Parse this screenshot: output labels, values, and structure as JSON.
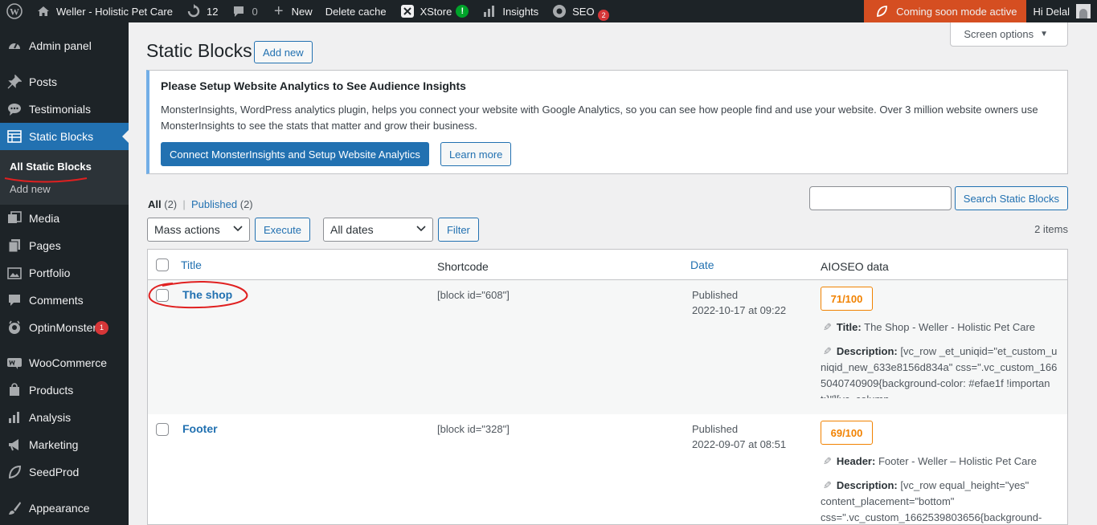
{
  "adminbar": {
    "site_name": "Weller - Holistic Pet Care",
    "updates_count": "12",
    "comments_count": "0",
    "new_label": "New",
    "delete_cache_label": "Delete cache",
    "xstore_label": "XStore",
    "insights_label": "Insights",
    "seo_label": "SEO",
    "seo_badge": "2",
    "coming_soon_label": "Coming soon mode active",
    "greeting": "Hi Delal"
  },
  "sidebar": {
    "items": [
      {
        "label": "Admin panel",
        "icon": "dashboard-icon"
      },
      {
        "label": "Posts",
        "icon": "pin-icon"
      },
      {
        "label": "Testimonials",
        "icon": "speech-bubble-icon"
      },
      {
        "label": "Static Blocks",
        "icon": "table-icon"
      },
      {
        "label": "Media",
        "icon": "media-icon"
      },
      {
        "label": "Pages",
        "icon": "pages-icon"
      },
      {
        "label": "Portfolio",
        "icon": "portfolio-icon"
      },
      {
        "label": "Comments",
        "icon": "comment-icon"
      },
      {
        "label": "OptinMonster",
        "icon": "optinmonster-icon",
        "badge": "1"
      },
      {
        "label": "WooCommerce",
        "icon": "woo-icon"
      },
      {
        "label": "Products",
        "icon": "archive-icon"
      },
      {
        "label": "Analysis",
        "icon": "bar-chart-icon"
      },
      {
        "label": "Marketing",
        "icon": "megaphone-icon"
      },
      {
        "label": "SeedProd",
        "icon": "seedprod-icon"
      },
      {
        "label": "Appearance",
        "icon": "brush-icon"
      }
    ],
    "submenu": {
      "all_label": "All Static Blocks",
      "add_label": "Add new"
    }
  },
  "main": {
    "screen_options_label": "Screen options",
    "page_title": "Static Blocks",
    "add_new_label": "Add new",
    "notice": {
      "title": "Please Setup Website Analytics to See Audience Insights",
      "body": "MonsterInsights, WordPress analytics plugin, helps you connect your website with Google Analytics, so you can see how people find and use your website. Over 3 million website owners use MonsterInsights to see the stats that matter and grow their business.",
      "primary_button": "Connect MonsterInsights and Setup Website Analytics",
      "secondary_button": "Learn more"
    },
    "filters": {
      "all_label": "All",
      "all_count": "(2)",
      "separator": "|",
      "published_label": "Published",
      "published_count": "(2)"
    },
    "search_button": "Search Static Blocks",
    "bulk_select": "Mass actions",
    "execute_button": "Execute",
    "dates_select": "All dates",
    "filter_button": "Filter",
    "items_count": "2 items",
    "table": {
      "headers": {
        "title": "Title",
        "shortcode": "Shortcode",
        "date": "Date",
        "aioseo": "AIOSEO data"
      },
      "rows": [
        {
          "title": "The shop",
          "shortcode": "[block id=\"608\"]",
          "status": "Published",
          "date": "2022-10-17 at 09:22",
          "score": "71/100",
          "seo_title_label": "Title:",
          "seo_title": "The Shop - Weller - Holistic Pet Care",
          "desc_label": "Description:",
          "desc": "[vc_row _et_uniqid=\"et_custom_uniqid_new_633e8156d834a\" css=\".vc_custom_1665040740909{background-color: #efae1f !important;}\"][vc_column"
        },
        {
          "title": "Footer",
          "shortcode": "[block id=\"328\"]",
          "status": "Published",
          "date": "2022-09-07 at 08:51",
          "score": "69/100",
          "seo_title_label": "Header:",
          "seo_title": "Footer - Weller – Holistic Pet Care",
          "desc_label": "Description:",
          "desc": "[vc_row equal_height=\"yes\" content_placement=\"bottom\" css=\".vc_custom_1662539803656{background-"
        }
      ]
    }
  },
  "colors": {
    "adminbar_bg": "#1d2327",
    "accent": "#2271b1",
    "coming_soon_bg": "#d54e21",
    "score_orange": "#f18200",
    "annotation_red": "#e02020"
  }
}
